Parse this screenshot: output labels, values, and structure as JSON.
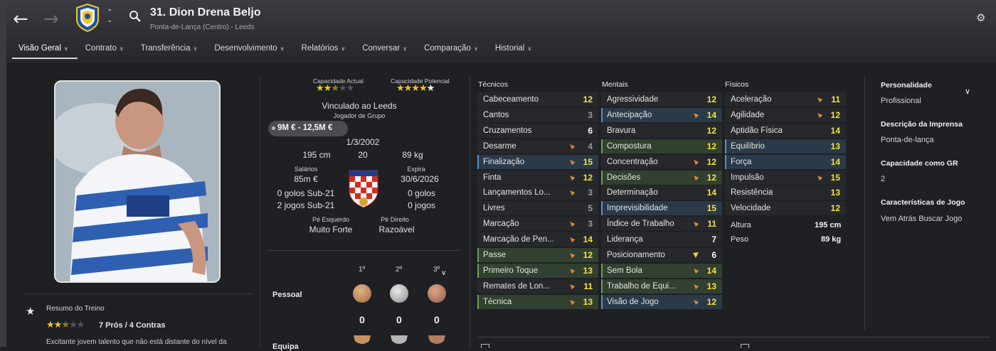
{
  "header": {
    "player_title": "31. Dion Drena Beljo",
    "player_subtitle": "Ponta-de-Lança (Centro) - Leeds",
    "back_icon": "arrow-left-icon",
    "forward_icon": "arrow-right-icon",
    "search_icon": "search-icon"
  },
  "tabs": [
    {
      "label": "Visão Geral",
      "active": true
    },
    {
      "label": "Contrato"
    },
    {
      "label": "Transferência"
    },
    {
      "label": "Desenvolvimento"
    },
    {
      "label": "Relatórios"
    },
    {
      "label": "Conversar"
    },
    {
      "label": "Comparação"
    },
    {
      "label": "Historial"
    }
  ],
  "training": {
    "title": "Resumo do Treino",
    "stars": 2.5,
    "pros_cons": "7 Prós / 4 Contras",
    "description": "Excitante jovem talento que não está distante do nível da"
  },
  "profile": {
    "current_ability_label": "Capacidade Actual",
    "current_ability_stars": 2.5,
    "potential_ability_label": "Capacidade Potencial",
    "potential_ability_stars": 4.5,
    "contract_club": "Vinculado ao Leeds",
    "squad_status": "Jogador de Grupo",
    "value": "9M € - 12,5M €",
    "birth_date": "1/3/2002",
    "height": "195 cm",
    "age": "20",
    "weight": "89 kg",
    "wage_label": "Salários",
    "wage": "85m €",
    "expires_label": "Expira",
    "expires": "30/6/2026",
    "u21_goals": "0 golos Sub-21",
    "u21_games": "2 jogos Sub-21",
    "goals": "0 golos",
    "games": "0 jogos",
    "left_foot_label": "Pé Esquerdo",
    "left_foot": "Muito Forte",
    "right_foot_label": "Pé Direito",
    "right_foot": "Razoável"
  },
  "awards": {
    "places": [
      "1º",
      "2º",
      "3º"
    ],
    "personal_label": "Pessoal",
    "personal_counts": [
      "0",
      "0",
      "0"
    ],
    "team_label": "Equipa"
  },
  "attributes": {
    "technical_title": "Técnicos",
    "mental_title": "Mentais",
    "physical_title": "Físicos",
    "technical": [
      {
        "name": "Cabeceamento",
        "value": "12",
        "arrow": false,
        "hl": ""
      },
      {
        "name": "Cantos",
        "value": "3",
        "arrow": false,
        "hl": ""
      },
      {
        "name": "Cruzamentos",
        "value": "6",
        "arrow": false,
        "hl": ""
      },
      {
        "name": "Desarme",
        "value": "4",
        "arrow": true,
        "hl": ""
      },
      {
        "name": "Finalização",
        "value": "15",
        "arrow": true,
        "hl": "blue"
      },
      {
        "name": "Finta",
        "value": "12",
        "arrow": true,
        "hl": ""
      },
      {
        "name": "Lançamentos Lo...",
        "value": "3",
        "arrow": true,
        "hl": ""
      },
      {
        "name": "Livres",
        "value": "5",
        "arrow": false,
        "hl": ""
      },
      {
        "name": "Marcação",
        "value": "3",
        "arrow": true,
        "hl": ""
      },
      {
        "name": "Marcação de Pen...",
        "value": "14",
        "arrow": true,
        "hl": ""
      },
      {
        "name": "Passe",
        "value": "12",
        "arrow": true,
        "hl": "green"
      },
      {
        "name": "Primeiro Toque",
        "value": "13",
        "arrow": true,
        "hl": "green"
      },
      {
        "name": "Remates de Lon...",
        "value": "11",
        "arrow": true,
        "hl": ""
      },
      {
        "name": "Técnica",
        "value": "13",
        "arrow": true,
        "hl": "green"
      }
    ],
    "mental": [
      {
        "name": "Agressividade",
        "value": "12",
        "arrow": false,
        "hl": ""
      },
      {
        "name": "Antecipação",
        "value": "14",
        "arrow": true,
        "hl": "blue"
      },
      {
        "name": "Bravura",
        "value": "12",
        "arrow": false,
        "hl": ""
      },
      {
        "name": "Compostura",
        "value": "12",
        "arrow": false,
        "hl": "green"
      },
      {
        "name": "Concentração",
        "value": "12",
        "arrow": true,
        "hl": ""
      },
      {
        "name": "Decisões",
        "value": "12",
        "arrow": true,
        "hl": "green"
      },
      {
        "name": "Determinação",
        "value": "14",
        "arrow": false,
        "hl": ""
      },
      {
        "name": "Imprevisibilidade",
        "value": "15",
        "arrow": false,
        "hl": "blue"
      },
      {
        "name": "Índice de Trabalho",
        "value": "11",
        "arrow": true,
        "hl": ""
      },
      {
        "name": "Liderança",
        "value": "7",
        "arrow": false,
        "hl": ""
      },
      {
        "name": "Posicionamento",
        "value": "6",
        "arrow": "yellow",
        "hl": ""
      },
      {
        "name": "Sem Bola",
        "value": "14",
        "arrow": true,
        "hl": "green"
      },
      {
        "name": "Trabalho de Equi...",
        "value": "13",
        "arrow": true,
        "hl": "green"
      },
      {
        "name": "Visão de Jogo",
        "value": "12",
        "arrow": true,
        "hl": "blue"
      }
    ],
    "physical": [
      {
        "name": "Aceleração",
        "value": "11",
        "arrow": true,
        "hl": ""
      },
      {
        "name": "Agilidade",
        "value": "12",
        "arrow": true,
        "hl": ""
      },
      {
        "name": "Aptidão Física",
        "value": "14",
        "arrow": false,
        "hl": ""
      },
      {
        "name": "Equilíbrio",
        "value": "13",
        "arrow": false,
        "hl": "blue"
      },
      {
        "name": "Força",
        "value": "14",
        "arrow": false,
        "hl": "blue"
      },
      {
        "name": "Impulsão",
        "value": "15",
        "arrow": true,
        "hl": ""
      },
      {
        "name": "Resistência",
        "value": "13",
        "arrow": false,
        "hl": ""
      },
      {
        "name": "Velocidade",
        "value": "12",
        "arrow": false,
        "hl": ""
      }
    ],
    "height_label": "Altura",
    "height": "195 cm",
    "weight_label": "Peso",
    "weight": "89 kg"
  },
  "side": {
    "personality_label": "Personalidade",
    "personality": "Profissional",
    "press_label": "Descrição da Imprensa",
    "press": "Ponta-de-lança",
    "gk_label": "Capacidade como GR",
    "gk": "2",
    "traits_label": "Características de Jogo",
    "traits": "Vem Atrás Buscar Jogo"
  }
}
